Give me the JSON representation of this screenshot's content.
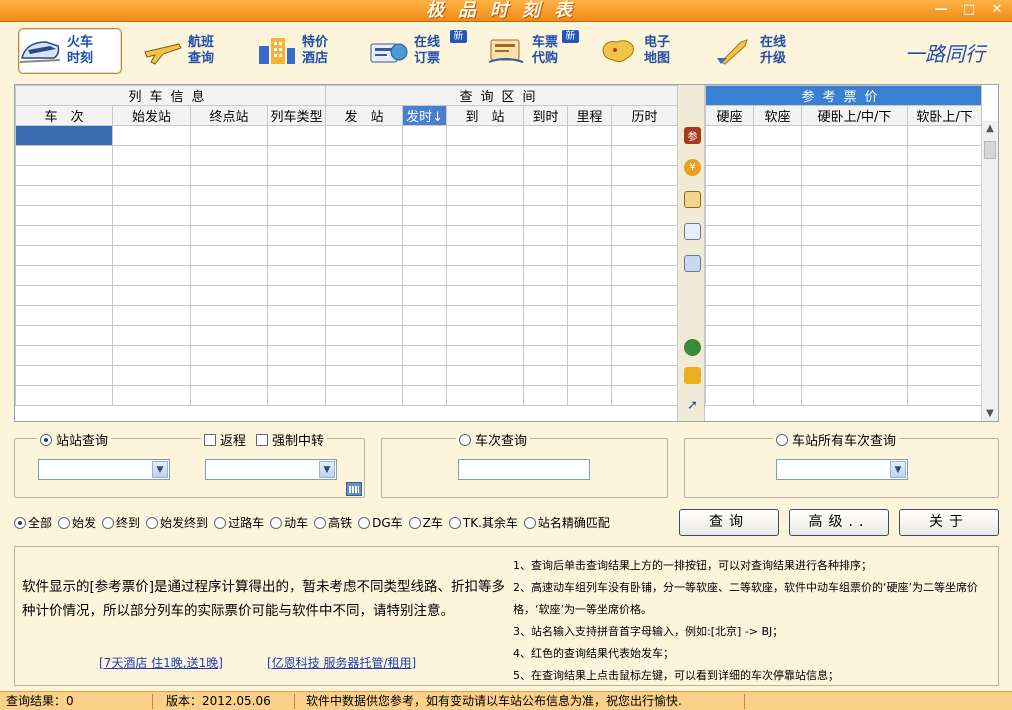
{
  "window": {
    "title": "极品时刻表",
    "minimize": "—",
    "maximize": "□",
    "close": "✕"
  },
  "toolbar": {
    "items": [
      {
        "label": "火车\n时刻",
        "icon": "train-icon",
        "active": true
      },
      {
        "label": "航班\n查询",
        "icon": "airplane-icon"
      },
      {
        "label": "特价\n酒店",
        "icon": "hotel-icon"
      },
      {
        "label": "在线\n订票",
        "icon": "ticket-icon",
        "badge": "新"
      },
      {
        "label": "车票\n代购",
        "icon": "purchase-icon",
        "badge": "新"
      },
      {
        "label": "电子\n地图",
        "icon": "map-icon"
      },
      {
        "label": "在线\n升级",
        "icon": "upgrade-icon"
      }
    ],
    "signature": "一路同行"
  },
  "grid": {
    "groups": {
      "train_info": "列车信息",
      "query_range": "查询区间",
      "ref_price": "参考票价"
    },
    "columns": [
      "车　次",
      "始发站",
      "终点站",
      "列车类型",
      "发　站",
      "发时↓",
      "到　站",
      "到时",
      "里程",
      "历时"
    ],
    "price_columns": [
      "硬座",
      "软座",
      "硬卧上/中/下",
      "软卧上/下"
    ],
    "sorted_column": "发时↓"
  },
  "sidebar": {
    "top_icon_text": "参",
    "coin_icon_text": "¥"
  },
  "station_query": {
    "label": "站站查询",
    "return_trip": "返程",
    "force_transfer": "强制中转"
  },
  "train_query": {
    "label": "车次查询"
  },
  "station_all_query": {
    "label": "车站所有车次查询"
  },
  "filters": [
    "全部",
    "始发",
    "终到",
    "始发终到",
    "过路车",
    "动车",
    "高铁",
    "DG车",
    "Z车",
    "TK.其余车",
    "站名精确匹配"
  ],
  "buttons": {
    "query": "查询",
    "advanced": "高级..",
    "close": "关于"
  },
  "info": {
    "notice": "软件显示的[参考票价]是通过程序计算得出的，暂未考虑不同类型线路、折扣等多种计价情况，所以部分列车的实际票价可能与软件中不同，请特别注意。",
    "link1": "[7天酒店 住1晚,送1晚]",
    "link2": "[亿恩科技 服务器托管/租用]",
    "tips": [
      "1、查询后单击查询结果上方的一排按钮，可以对查询结果进行各种排序；",
      "2、高速动车组列车没有卧铺，分一等软座、二等软座，软件中动车组票价的‘硬座’为二等坐席价格，‘软座’为一等坐席价格。",
      "3、站名输入支持拼音首字母输入，例如:[北京] -> BJ；",
      "4、红色的查询结果代表始发车；",
      "5、在查询结果上点击鼠标左键，可以看到详细的车次停靠站信息；"
    ]
  },
  "status": {
    "result": "查询结果：0",
    "version": "版本：2012.05.06",
    "message": "软件中数据供您参考，如有变动请以车站公布信息为准，祝您出行愉快."
  },
  "colors": {
    "accent": "#f08a1a",
    "link": "#1f4fa8",
    "selection": "#3a6cb0",
    "price_header": "#3a80d0"
  }
}
